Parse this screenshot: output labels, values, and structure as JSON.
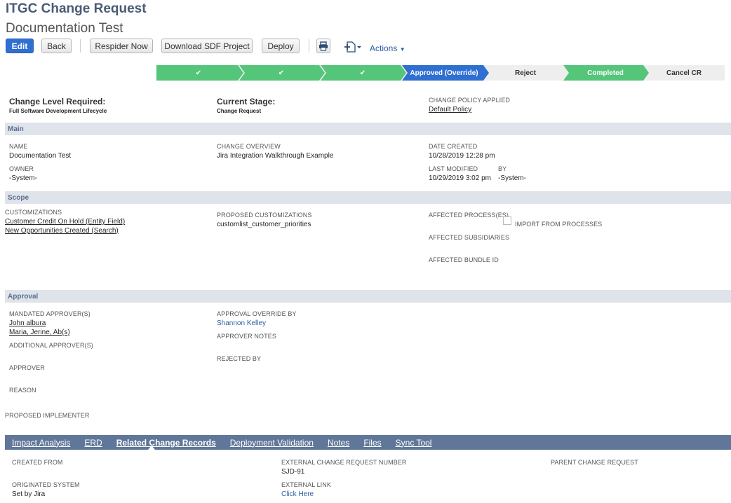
{
  "header": {
    "title": "ITGC Change Request",
    "subtitle": "Documentation Test"
  },
  "toolbar": {
    "edit": "Edit",
    "back": "Back",
    "respider": "Respider Now",
    "download": "Download SDF Project",
    "deploy": "Deploy",
    "actions": "Actions"
  },
  "stages": [
    {
      "label": "✔",
      "state": "done"
    },
    {
      "label": "✔",
      "state": "done"
    },
    {
      "label": "✔",
      "state": "done"
    },
    {
      "label": "Approved (Override)",
      "state": "current"
    },
    {
      "label": "Reject",
      "state": "pending"
    },
    {
      "label": "Completed",
      "state": "done"
    },
    {
      "label": "Cancel CR",
      "state": "pending"
    }
  ],
  "summary": {
    "level_label": "Change Level Required:",
    "level_value": "Full Software Development Lifecycle",
    "stage_label": "Current Stage:",
    "stage_value": "Change Request",
    "policy_label": "CHANGE POLICY APPLIED",
    "policy_value": "Default Policy"
  },
  "main": {
    "section": "Main",
    "name_label": "NAME",
    "name_value": "Documentation Test",
    "owner_label": "OWNER",
    "owner_value": "-System-",
    "overview_label": "CHANGE OVERVIEW",
    "overview_value": "Jira Integration Walkthrough Example",
    "created_label": "DATE CREATED",
    "created_value": "10/28/2019 12:28 pm",
    "modified_label": "LAST MODIFIED",
    "modified_value": "10/29/2019 3:02 pm",
    "by_label": "BY",
    "by_value": "-System-"
  },
  "scope": {
    "section": "Scope",
    "customizations_label": "CUSTOMIZATIONS",
    "customizations": [
      "Customer Credit On Hold (Entity Field)",
      "New Opportunities Created (Search)"
    ],
    "proposed_label": "PROPOSED CUSTOMIZATIONS",
    "proposed_value": "customlist_customer_priorities",
    "processes_label": "AFFECTED PROCESS(ES)",
    "import_label": "IMPORT FROM PROCESSES",
    "subsidiaries_label": "AFFECTED SUBSIDIARIES",
    "bundle_label": "AFFECTED BUNDLE ID"
  },
  "approval": {
    "section": "Approval",
    "mandated_label": "MANDATED APPROVER(S)",
    "mandated": [
      "John albura",
      "Maria, Jerine, Ab(s)"
    ],
    "additional_label": "ADDITIONAL APPROVER(S)",
    "approver_label": "APPROVER",
    "reason_label": "REASON",
    "override_label": "APPROVAL OVERRIDE BY",
    "override_value": "Shannon Kelley",
    "notes_label": "APPROVER NOTES",
    "rejected_label": "REJECTED BY",
    "implementer_label": "PROPOSED IMPLEMENTER"
  },
  "tabs": [
    {
      "label": "Impact Analysis",
      "accel": "I"
    },
    {
      "label": "ERD",
      "accel": "E"
    },
    {
      "label": "Related Change Records",
      "accel": "R",
      "active": true
    },
    {
      "label": "Deployment Validation",
      "accel": "D"
    },
    {
      "label": "Notes",
      "accel": "N"
    },
    {
      "label": "Files",
      "accel": "F"
    },
    {
      "label": "Sync Tool",
      "accel": "S"
    }
  ],
  "related": {
    "created_from_label": "CREATED FROM",
    "originated_label": "ORIGINATED SYSTEM",
    "originated_value": "Set by Jira",
    "ext_number_label": "EXTERNAL CHANGE REQUEST NUMBER",
    "ext_number_value": "SJD-91",
    "ext_link_label": "EXTERNAL LINK",
    "ext_link_value": "Click Here",
    "parent_label": "PARENT CHANGE REQUEST"
  },
  "colors": {
    "done": "#55c57a",
    "current": "#2f6fd1",
    "pending": "#eeeeee",
    "tabbar": "#607799"
  }
}
